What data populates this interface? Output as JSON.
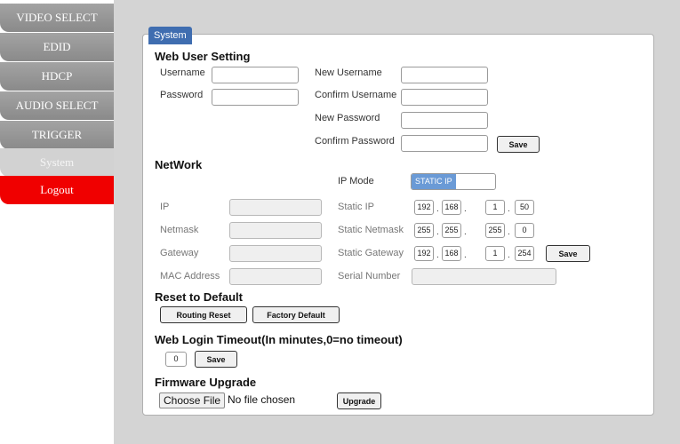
{
  "sidebar": {
    "items": [
      {
        "label": "VIDEO SELECT"
      },
      {
        "label": "EDID"
      },
      {
        "label": "HDCP"
      },
      {
        "label": "AUDIO SELECT"
      },
      {
        "label": "TRIGGER"
      },
      {
        "label": "System"
      },
      {
        "label": "Logout"
      }
    ]
  },
  "panel": {
    "tab_title": "System"
  },
  "web_user": {
    "heading": "Web User Setting",
    "username_label": "Username",
    "password_label": "Password",
    "new_username_label": "New Username",
    "confirm_username_label": "Confirm Username",
    "new_password_label": "New Password",
    "confirm_password_label": "Confirm Password",
    "save_label": "Save"
  },
  "network": {
    "heading": "NetWork",
    "ip_mode_label": "IP Mode",
    "ip_mode_value": "STATIC IP",
    "ip_label": "IP",
    "netmask_label": "Netmask",
    "gateway_label": "Gateway",
    "mac_label": "MAC Address",
    "static_ip_label": "Static IP",
    "static_netmask_label": "Static Netmask",
    "static_gateway_label": "Static Gateway",
    "serial_label": "Serial Number",
    "static_ip": [
      "192",
      "168",
      "1",
      "50"
    ],
    "static_netmask": [
      "255",
      "255",
      "255",
      "0"
    ],
    "static_gateway": [
      "192",
      "168",
      "1",
      "254"
    ],
    "dot": ".",
    "save_label": "Save"
  },
  "reset": {
    "heading": "Reset to Default",
    "routing_reset_label": "Routing Reset",
    "factory_default_label": "Factory Default"
  },
  "timeout": {
    "heading": "Web Login Timeout(In minutes,0=no timeout)",
    "value": "0",
    "save_label": "Save"
  },
  "firmware": {
    "heading": "Firmware Upgrade",
    "choose_file_label": "Choose File",
    "no_file_text": "No file chosen",
    "upgrade_label": "Upgrade"
  }
}
